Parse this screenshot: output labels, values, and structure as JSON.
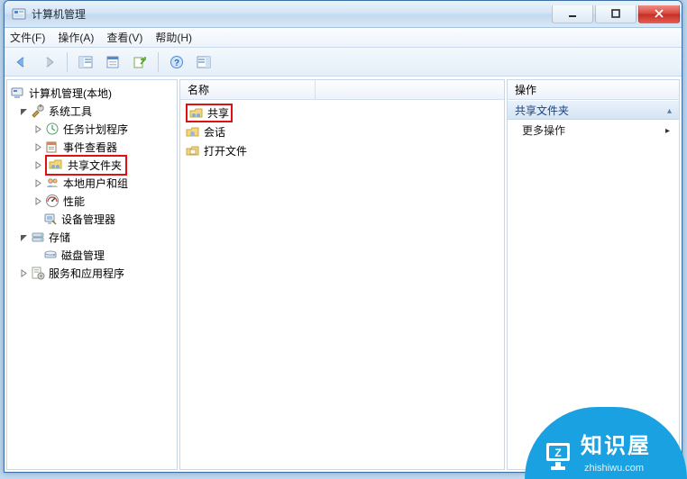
{
  "window": {
    "title": "计算机管理"
  },
  "menu": {
    "file": "文件(F)",
    "action": "操作(A)",
    "view": "查看(V)",
    "help": "帮助(H)"
  },
  "tree": {
    "root": "计算机管理(本地)",
    "system_tools": "系统工具",
    "task_scheduler": "任务计划程序",
    "event_viewer": "事件查看器",
    "shared_folders": "共享文件夹",
    "local_users": "本地用户和组",
    "performance": "性能",
    "device_manager": "设备管理器",
    "storage": "存储",
    "disk_management": "磁盘管理",
    "services_apps": "服务和应用程序"
  },
  "list": {
    "header_name": "名称",
    "items": {
      "shares": "共享",
      "sessions": "会话",
      "open_files": "打开文件"
    }
  },
  "actions": {
    "header": "操作",
    "group_title": "共享文件夹",
    "more": "更多操作"
  },
  "watermark": {
    "text": "知识屋",
    "url": "zhishiwu.com"
  }
}
